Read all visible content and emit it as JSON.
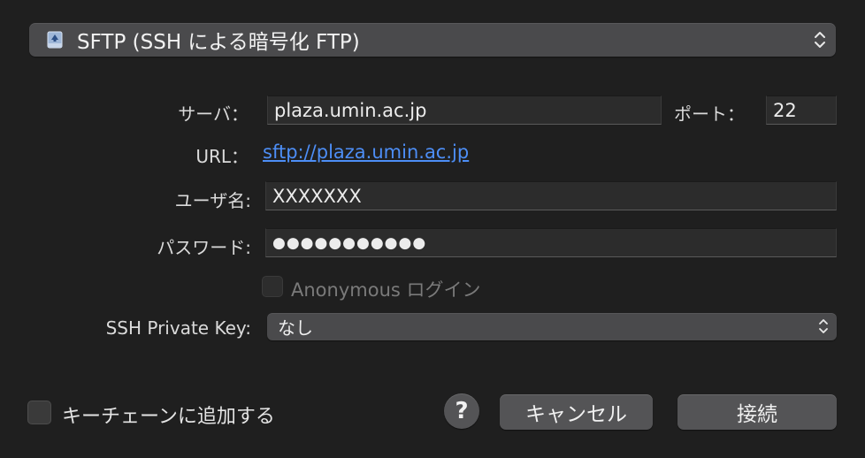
{
  "protocol": {
    "selected": "SFTP (SSH による暗号化 FTP)",
    "icon": "drive-icon"
  },
  "server": {
    "label": "サーバ：",
    "value": "plaza.umin.ac.jp"
  },
  "port": {
    "label": "ポート：",
    "value": "22"
  },
  "url": {
    "label": "URL：",
    "value": "sftp://plaza.umin.ac.jp"
  },
  "username": {
    "label": "ユーザ名:",
    "value": "XXXXXXX"
  },
  "password": {
    "label": "パスワード:",
    "value": "●●●●●●●●●●●"
  },
  "anonymous": {
    "label": "Anonymous ログイン",
    "checked": false,
    "enabled": false
  },
  "private_key": {
    "label": "SSH Private Key:",
    "selected": "なし"
  },
  "keychain": {
    "label": "キーチェーンに追加する",
    "checked": false
  },
  "buttons": {
    "help": "?",
    "cancel": "キャンセル",
    "connect": "接続"
  },
  "colors": {
    "background": "#1f1f1f",
    "link": "#4d8ef6",
    "control": "#4a4a4c"
  }
}
